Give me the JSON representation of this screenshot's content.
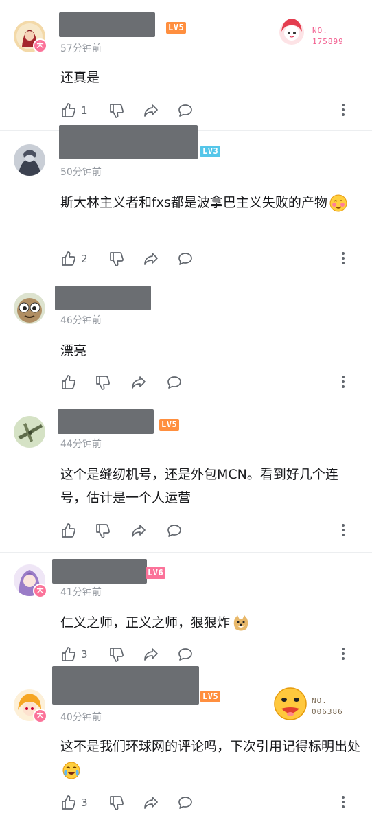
{
  "icons": {
    "like": "thumbs-up-icon",
    "dislike": "thumbs-down-icon",
    "share": "share-arrow-icon",
    "reply": "chat-bubble-icon",
    "more": "more-vertical-icon"
  },
  "colors": {
    "lv5": "#ff8f3f",
    "lv3": "#55c6e9",
    "lv6": "#fb7299",
    "vip_badge": "#fb7299"
  },
  "comments": [
    {
      "time": "57分钟前",
      "text": "还真是",
      "level": "LV5",
      "likes": "1",
      "fan_no_label": "NO.",
      "fan_no": "175899",
      "badge": "大"
    },
    {
      "time": "50分钟前",
      "text": "斯大林主义者和fxs都是波拿巴主义失败的产物",
      "likes": "2",
      "level": "LV3"
    },
    {
      "time": "46分钟前",
      "text": "漂亮",
      "likes": ""
    },
    {
      "time": "44分钟前",
      "text": "这个是缝纫机号，还是外包MCN。看到好几个连号，估计是一个人运营",
      "level": "LV5",
      "likes": ""
    },
    {
      "time": "41分钟前",
      "text": "仁义之师，正义之师，狠狠炸",
      "level": "LV6",
      "likes": "3",
      "badge": "大"
    },
    {
      "time": "40分钟前",
      "text": "这不是我们环球网的评论吗，下次引用记得标明出处",
      "level": "LV5",
      "likes": "3",
      "fan_no_label": "NO.",
      "fan_no": "006386",
      "badge": "大"
    }
  ]
}
